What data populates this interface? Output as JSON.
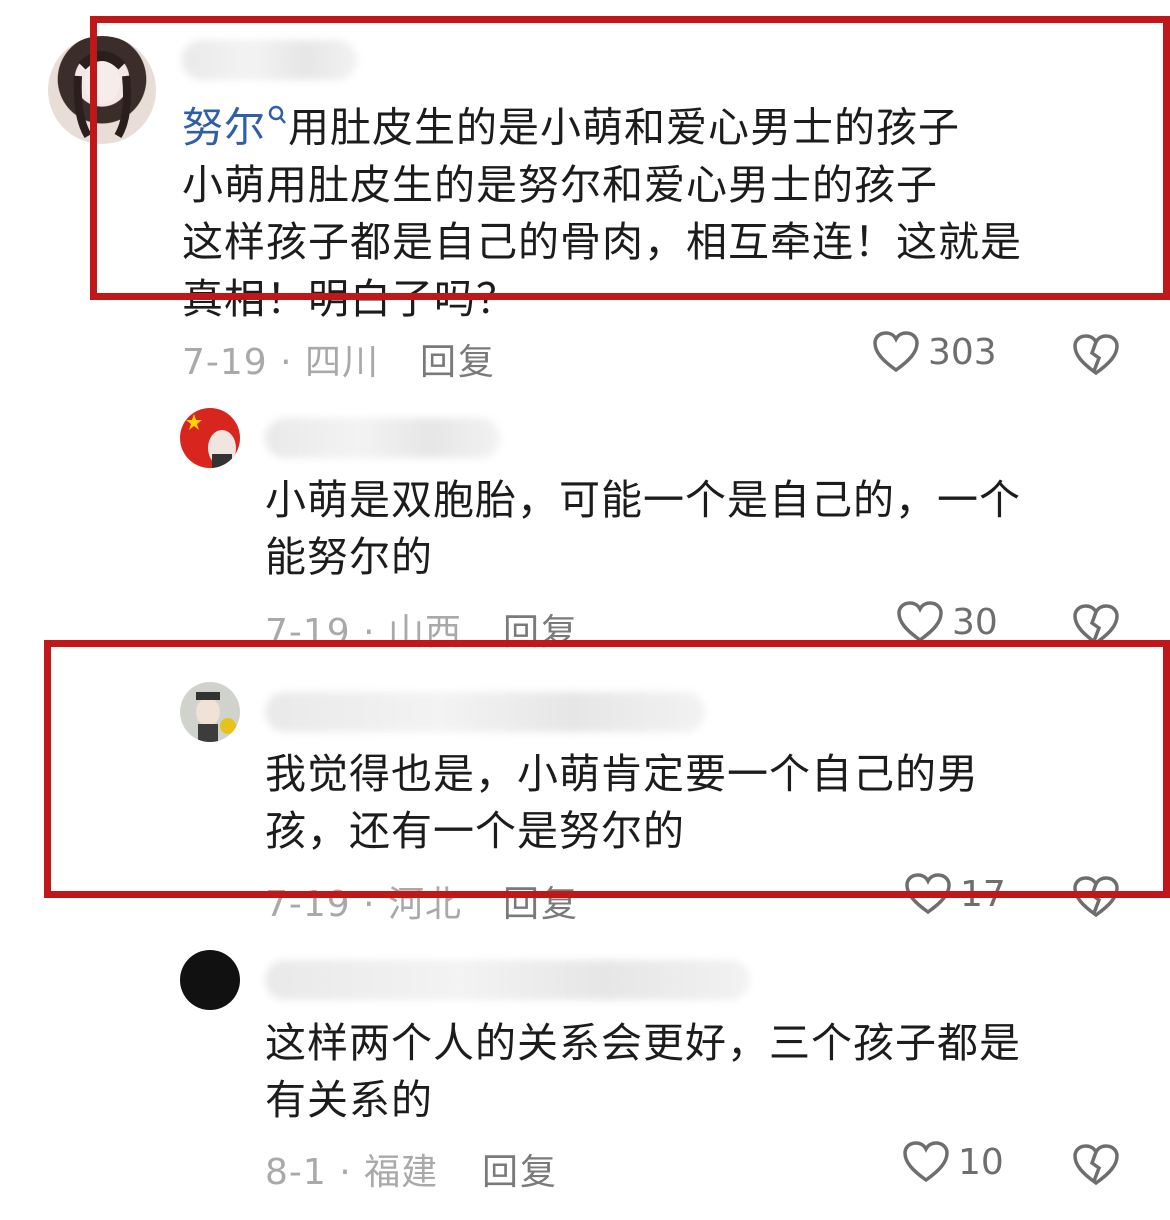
{
  "comments": [
    {
      "mention": "努尔",
      "text_line1_rest": "用肚皮生的是小萌和爱心男士的孩子",
      "text_rest": "小萌用肚皮生的是努尔和爱心男士的孩子\n这样孩子都是自己的骨肉，相互牵连！这就是\n真相！明白了吗？",
      "date_location": "7-19 · 四川",
      "reply_label": "回复",
      "likes": "303"
    },
    {
      "text": "小萌是双胞胎，可能一个是自己的，一个\n能努尔的",
      "date_location": "7-19 · 山西",
      "reply_label": "回复",
      "likes": "30"
    },
    {
      "text": "我觉得也是，小萌肯定要一个自己的男\n孩，还有一个是努尔的",
      "date_location": "7-19 · 河北",
      "reply_label": "回复",
      "likes": "17"
    },
    {
      "text": "这样两个人的关系会更好，三个孩子都是\n有关系的",
      "date_location": "8-1 · 福建",
      "reply_label": "回复",
      "likes": "10"
    }
  ],
  "icons": {
    "like": "heart-outline-icon",
    "dislike": "broken-heart-icon",
    "mention_search": "search-icon"
  },
  "colors": {
    "mention": "#2f5fa8",
    "highlight_box": "#c0171b",
    "meta": "#a9a9a9"
  }
}
